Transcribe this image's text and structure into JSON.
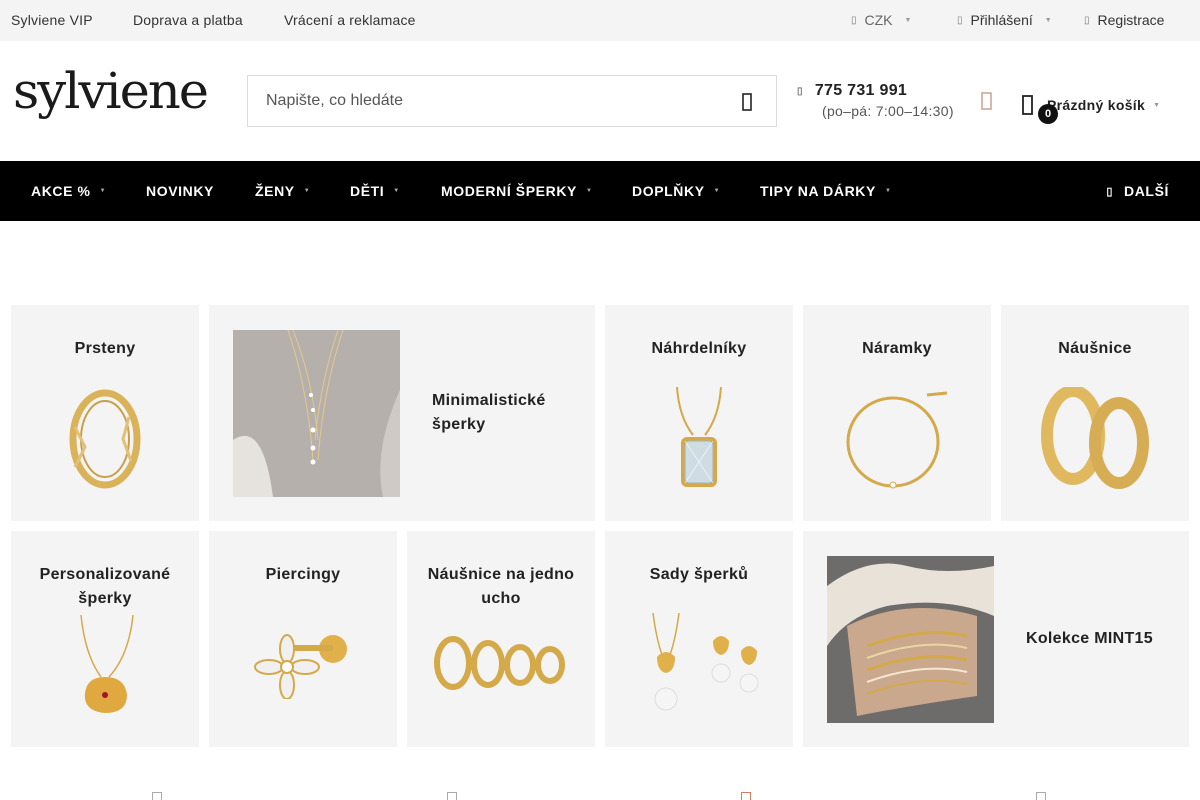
{
  "topbar": {
    "links": [
      "Sylviene VIP",
      "Doprava a platba",
      "Vrácení a reklamace"
    ],
    "currency": "CZK",
    "login": "Přihlášení",
    "register": "Registrace"
  },
  "header": {
    "logo_text": "sylviene",
    "search_placeholder": "Napište, co hledáte",
    "phone": "775 731 991",
    "hours": "(po–pá: 7:00–14:30)",
    "cart_count": "0",
    "cart_label": "Prázdný košík"
  },
  "nav": {
    "items": [
      "AKCE %",
      "NOVINKY",
      "ŽENY",
      "DĚTI",
      "MODERNÍ ŠPERKY",
      "DOPLŇKY",
      "TIPY NA DÁRKY"
    ],
    "more": "DALŠÍ"
  },
  "categories": [
    {
      "name": "Prsteny",
      "icon": "ring-icon"
    },
    {
      "name": "Minimalistické šperky",
      "icon": "necklace-photo"
    },
    {
      "name": "Náhrdelníky",
      "icon": "pendant-necklace-icon"
    },
    {
      "name": "Náramky",
      "icon": "bracelet-icon"
    },
    {
      "name": "Náušnice",
      "icon": "hoop-earrings-icon"
    },
    {
      "name": "Personalizované šperky",
      "icon": "medallion-necklace-icon"
    },
    {
      "name": "Piercingy",
      "icon": "flower-piercing-icon"
    },
    {
      "name": "Náušnice na jedno ucho",
      "icon": "mini-hoops-icon"
    },
    {
      "name": "Sady šperků",
      "icon": "jewelry-set-icon"
    },
    {
      "name": "Kolekce MINT15",
      "icon": "bracelets-photo"
    }
  ],
  "colors": {
    "nav_bg": "#000000",
    "tile_bg": "#f4f4f4",
    "gold": "#d4a94a",
    "wishlist": "#c9a290"
  }
}
